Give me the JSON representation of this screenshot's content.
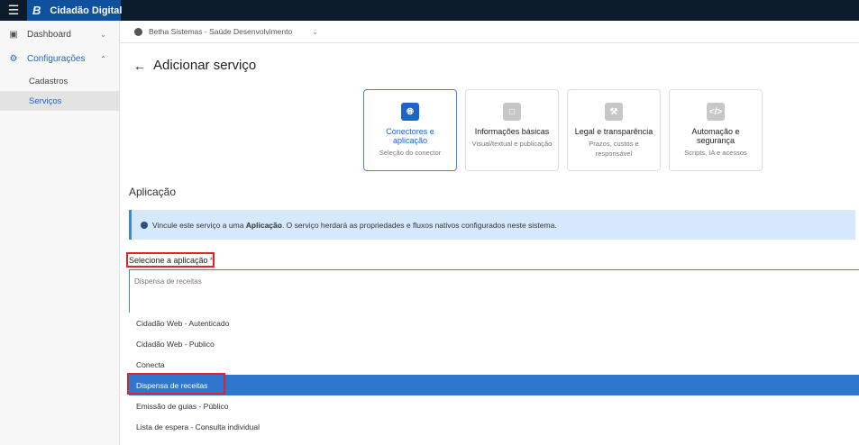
{
  "topbar": {
    "menu_icon": "hamburger-menu-icon",
    "brand_logo": "B",
    "brand_name": "Cidadão Digital"
  },
  "sidebar": {
    "items": [
      {
        "label": "Dashboard",
        "icon": "monitor-icon",
        "expanded": false
      },
      {
        "label": "Configurações",
        "icon": "settings-icon",
        "expanded": true,
        "children": [
          {
            "label": "Cadastros",
            "current": false
          },
          {
            "label": "Serviços",
            "current": true
          }
        ]
      }
    ]
  },
  "context": {
    "entity": "Betha Sistemas - Saúde Desenvolvimento"
  },
  "page": {
    "back_icon": "←",
    "title": "Adicionar serviço"
  },
  "steps": [
    {
      "title": "Conectores e aplicação",
      "description": "Seleção do conector",
      "icon": "globe-icon",
      "active": true
    },
    {
      "title": "Informações básicas",
      "description": "Visual/textual e publicação",
      "icon": "document-icon",
      "active": false
    },
    {
      "title": "Legal e transparência",
      "description": "Prazos, custos e responsável",
      "icon": "gavel-icon",
      "active": false
    },
    {
      "title": "Automação e segurança",
      "description": "Scripts, IA e acessos",
      "icon": "code-icon",
      "active": false
    }
  ],
  "section": {
    "title": "Aplicação"
  },
  "info": {
    "prefix": "Vincule este serviço a uma ",
    "bold": "Aplicação",
    "suffix": ". O serviço herdará as propriedades e fluxos nativos configurados neste sistema."
  },
  "field": {
    "label": "Selecione a aplicação",
    "required_mark": "*",
    "value": "Dispensa de receitas"
  },
  "options": [
    "Cidadão Web - Autenticado",
    "Cidadão Web - Publico",
    "Conecta",
    "Dispensa de receitas",
    "Emissão de guias - Público",
    "Lista de espera - Consulta individual"
  ],
  "selected_option": "Dispensa de receitas",
  "colors": {
    "accent": "#1c64c8",
    "topbar": "#0c1b2b",
    "highlight": "#e0242a",
    "info_bg": "#d6e8fb"
  }
}
